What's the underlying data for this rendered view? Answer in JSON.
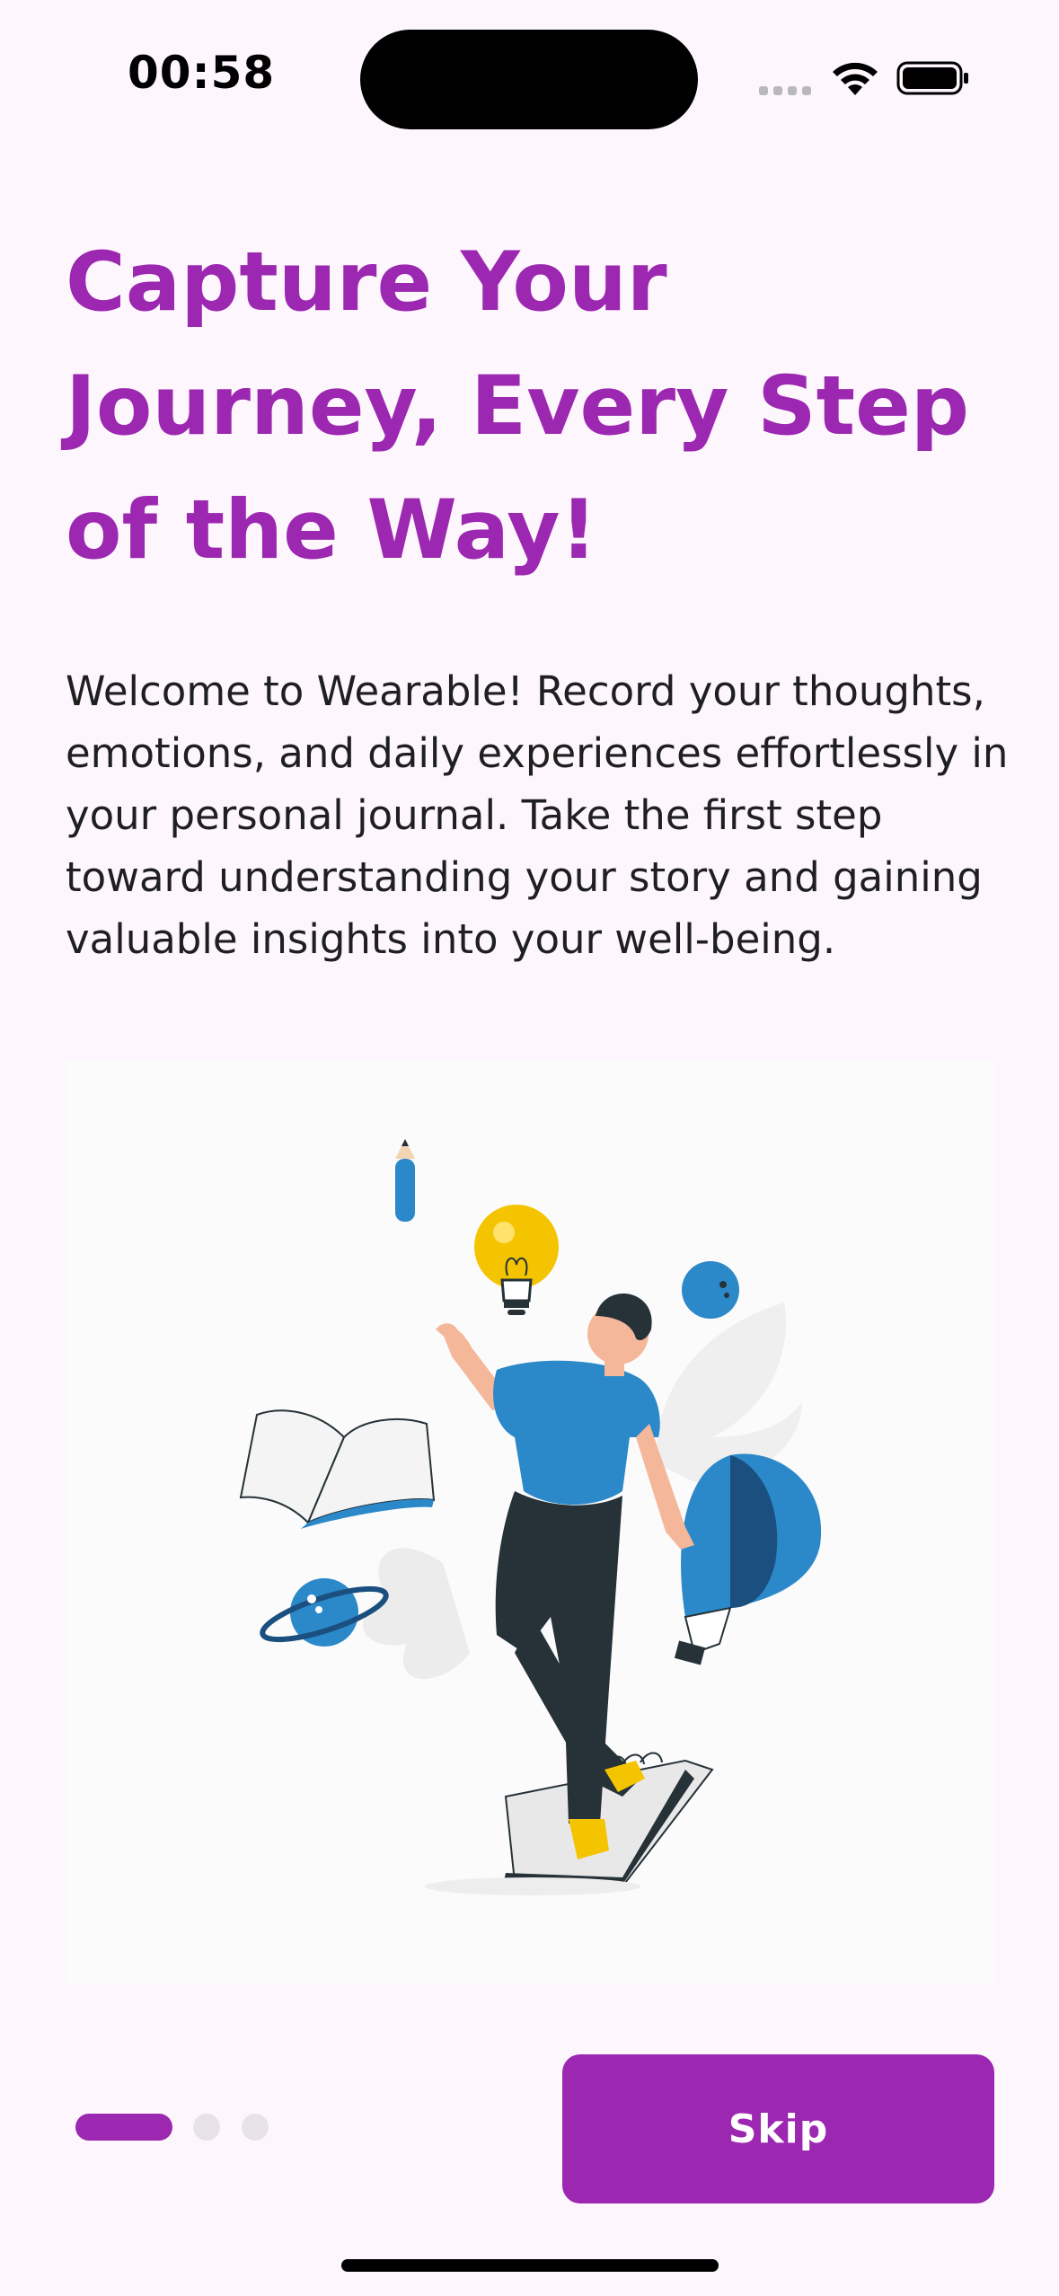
{
  "status_bar": {
    "time": "00:58"
  },
  "onboarding": {
    "headline": "Capture Your Journey, Every Step of the Way!",
    "description": "Welcome to Wearable! Record your thoughts, emotions, and daily experiences effortlessly in your personal journal. Take the first step toward understanding your story and gaining valuable insights into your well-being.",
    "illustration_icon": "person-with-ideas-illustration"
  },
  "pagination": {
    "total_pages": 3,
    "current_page": 1
  },
  "actions": {
    "skip_label": "Skip"
  },
  "colors": {
    "accent": "#9c27b0",
    "background": "#fdf7fd",
    "inactive_dot": "#e6e2e6"
  }
}
